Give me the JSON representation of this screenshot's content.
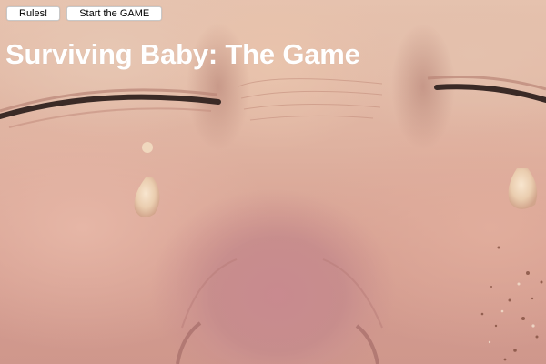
{
  "buttons": {
    "rules_label": "Rules!",
    "start_label": "Start the GAME"
  },
  "title": "Surviving Baby: The Game",
  "background": {
    "icon": "baby-face-photo",
    "dominant_color": "#d9a595"
  }
}
